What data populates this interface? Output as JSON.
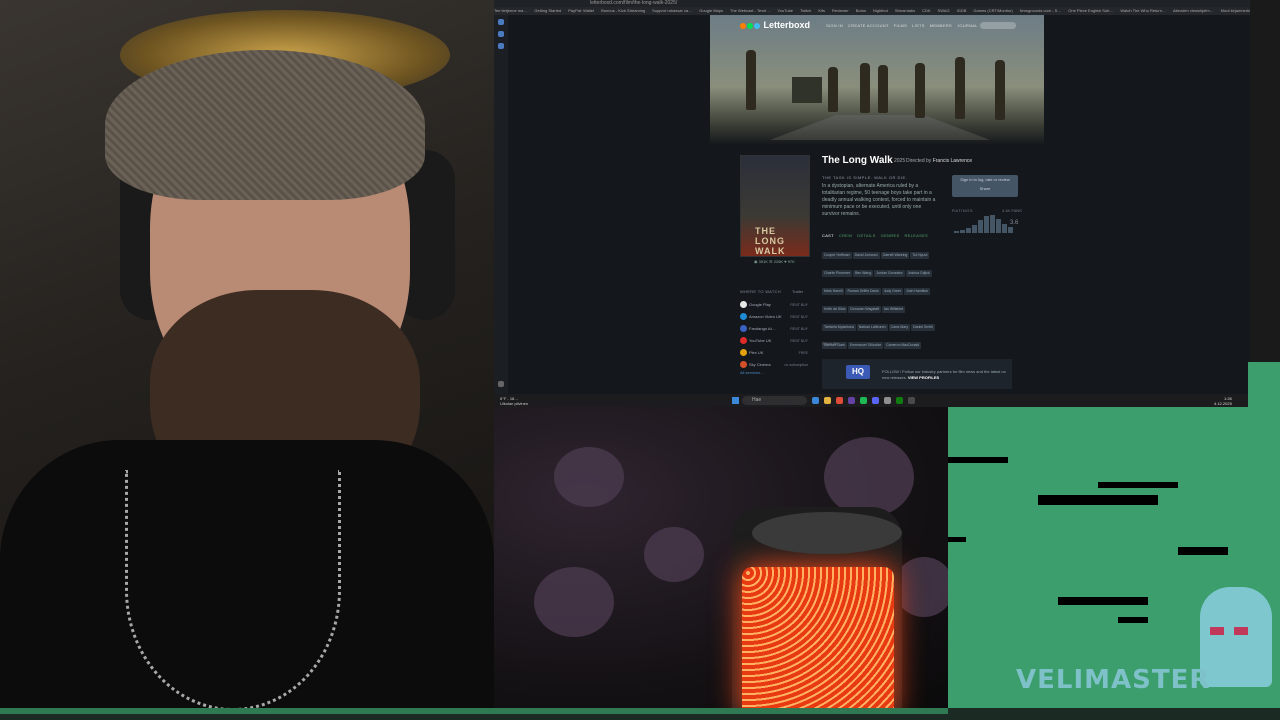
{
  "browser": {
    "url": "letterboxd.com/film/the-long-walk-2025/",
    "bookmarks": [
      "Tee tietjenne ma…",
      "Getting Started",
      "PayPal: Wallet",
      "Bonnus - Kick Streaming",
      "Supprot rahaxsar ca…",
      "Google Maps",
      "The Webcast - Tevel…",
      "YouTube",
      "Twitch",
      "Kits",
      "Reviewer",
      "Botos",
      "Nightbot",
      "Streamlabs",
      "CDK",
      "SWAG",
      "IGDB",
      "Games (CRT/Monitor)",
      "Nmsgrounds.com - S…",
      "One Piece English Sub…",
      "Watch The Who Return…",
      "Aiteuden viesiohjelm…",
      "Muut kirjanmerkit"
    ]
  },
  "letterboxd": {
    "logo": "Letterboxd",
    "nav": [
      "SIGN IN",
      "CREATE ACCOUNT",
      "FILMS",
      "LISTS",
      "MEMBERS",
      "JOURNAL"
    ],
    "film": {
      "title": "The Long Walk",
      "year": "2025",
      "directed_by_label": "Directed by",
      "director": "Francis Lawrence",
      "tagline": "THE TASK IS SIMPLE. WALK OR DIE.",
      "synopsis": "In a dystopian, alternate America ruled by a totalitarian regime, 50 teenage boys take part in a deadly annual walking contest, forced to maintain a minimum pace or be executed, until only one survivor remains.",
      "poster_title": "THE LONG WALK",
      "poster_stats": "◉ 351K   ☰ 226K   ♥ 97K"
    },
    "tabs": [
      "CAST",
      "CREW",
      "DETAILS",
      "GENRES",
      "RELEASES"
    ],
    "cast": [
      "Cooper Hoffman",
      "David Jonsson",
      "Garrett Wareing",
      "Tut Nyuot",
      "Charlie Plummer",
      "Ben Wang",
      "Jordan Gonzalez",
      "Joshua Odjick",
      "Mark Hamill",
      "Roman Griffin Davis",
      "Judy Greer",
      "Josh Hamilton",
      "Keith da Silva",
      "Donovan Wagstaff",
      "Ian Wiltshire",
      "Tsetsela Myambwa",
      "Nathan Lafleuren",
      "Carra Mary",
      "Daniel Smith",
      "Samuel Clark",
      "Emmanuel Giliochie",
      "Cameron MacDonald",
      "Nathan Daniels",
      "Aidan Murray",
      "Marina Stephenson Kerr",
      "Julianna Denham",
      "Luke Ling",
      "Roger Bell-Barnes",
      "Steven Barnhill",
      "Wenzel Bo"
    ],
    "cast_more": "Show All…",
    "signin_box": [
      "Sign in to log, rate or review",
      "Share"
    ],
    "ratings_label": "RATINGS",
    "ratings_fans": "4.4K FANS",
    "rating_avg": "3.6",
    "histogram": [
      0.12,
      0.18,
      0.28,
      0.45,
      0.7,
      0.95,
      1.0,
      0.8,
      0.5,
      0.35
    ],
    "where_to_watch": "WHERE TO WATCH",
    "trailer": "Trailer",
    "services": [
      {
        "name": "Google Play",
        "price": "RENT  BUY",
        "color": "#e8e8e8"
      },
      {
        "name": "Amazon Video UK",
        "price": "RENT  BUY",
        "color": "#1f8ad6"
      },
      {
        "name": "Fandango At…",
        "price": "RENT  BUY",
        "color": "#3a62c4"
      },
      {
        "name": "YouTube UK",
        "price": "RENT  BUY",
        "color": "#e02b2b"
      },
      {
        "name": "Plex UK",
        "price": "FREE",
        "color": "#e5a00d"
      },
      {
        "name": "Sky Cinema",
        "price": "no subscription",
        "color": "#d4502a"
      }
    ],
    "all_services": "All services…",
    "hq_label": "HQ",
    "hq_text_lead": "FOLLOW / Follow our industry partners for film news and the latest on new releases.",
    "hq_link": "VIEW PROFILES"
  },
  "taskbar": {
    "weather_temp": "6°F - 18…",
    "weather_desc": "Ulkolan pilvinen",
    "search_label": "Hae",
    "time": "1:28",
    "date": "4.12.2025"
  },
  "overlay": {
    "watermark": "VELIMASTER"
  },
  "colors": {
    "letterboxd_bg": "#14181c",
    "game_green": "#3c9e6c",
    "mic_red": "#e83a12",
    "lb_orange": "#ff8000",
    "lb_green": "#00e054",
    "lb_blue": "#40bcf4"
  }
}
